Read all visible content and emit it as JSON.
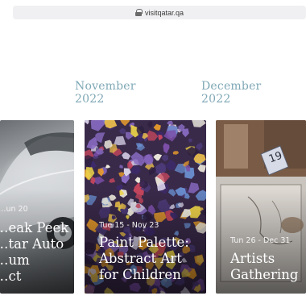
{
  "browser": {
    "url": "visitqatar.qa",
    "lock_icon": "lock-icon"
  },
  "months": [
    {
      "month": "November",
      "year": "2022"
    },
    {
      "month": "December",
      "year": "2022"
    }
  ],
  "events": [
    {
      "dates": "…un 20",
      "title_lines": [
        "…eak Peek",
        "…tar Auto",
        "…um",
        "…ct"
      ]
    },
    {
      "dates": "Tue 15 - Nov 23",
      "title_lines": [
        "Paint Palette:",
        "Abstract Art",
        "for Children"
      ]
    },
    {
      "dates": "Tun 26 - Dec 31",
      "badge": "19",
      "title_lines": [
        "Artists",
        "Gathering"
      ]
    }
  ]
}
